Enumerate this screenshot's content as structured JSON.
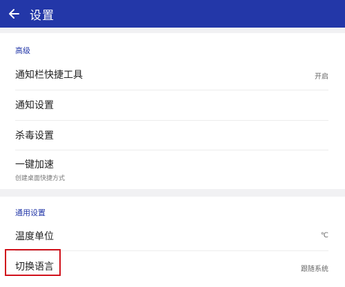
{
  "appbar": {
    "title": "设置",
    "back_icon": "arrow-left-icon",
    "background": "#2337a8"
  },
  "sections": [
    {
      "header": "高级",
      "items": [
        {
          "label": "通知栏快捷工具",
          "value": "开启"
        },
        {
          "label": "通知设置"
        },
        {
          "label": "杀毒设置"
        },
        {
          "label": "一键加速",
          "subtitle": "创建桌面快捷方式"
        }
      ]
    },
    {
      "header": "通用设置",
      "items": [
        {
          "label": "温度单位",
          "value": "℃"
        },
        {
          "label": "切换语言",
          "value": "跟随系统"
        }
      ]
    }
  ],
  "colors": {
    "accent": "#2337a8",
    "highlight_border": "#d0101a"
  }
}
